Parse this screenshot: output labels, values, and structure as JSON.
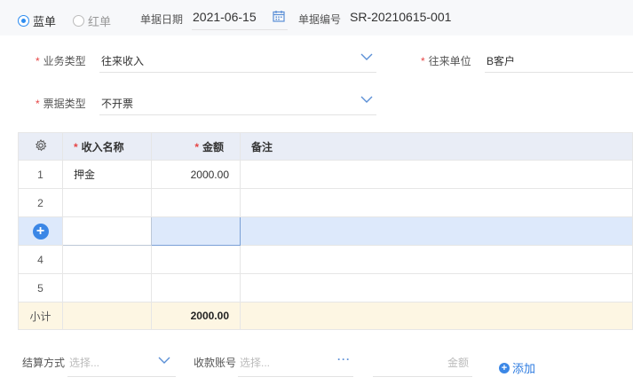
{
  "header": {
    "type_blue": "蓝单",
    "type_red": "红单",
    "date_label": "单据日期",
    "date_value": "2021-06-15",
    "no_label": "单据编号",
    "no_value": "SR-20210615-001"
  },
  "form": {
    "business_type_label": "业务类型",
    "business_type_value": "往来收入",
    "partner_label": "往来单位",
    "partner_value": "B客户",
    "invoice_type_label": "票据类型",
    "invoice_type_value": "不开票",
    "required_mark": "*"
  },
  "table": {
    "headers": {
      "name": "收入名称",
      "amount": "金额",
      "note": "备注"
    },
    "rows": [
      {
        "idx": "1",
        "name": "押金",
        "amount": "2000.00",
        "note": ""
      },
      {
        "idx": "2",
        "name": "",
        "amount": "",
        "note": ""
      },
      {
        "idx": "",
        "name": "",
        "amount": "",
        "note": ""
      },
      {
        "idx": "4",
        "name": "",
        "amount": "",
        "note": ""
      },
      {
        "idx": "5",
        "name": "",
        "amount": "",
        "note": ""
      }
    ],
    "subtotal_label": "小计",
    "subtotal_amount": "2000.00"
  },
  "settlement": {
    "method_label": "结算方式",
    "method_placeholder": "选择...",
    "account_label": "收款账号",
    "account_placeholder": "选择...",
    "amount_placeholder": "金额",
    "add_label": "添加"
  },
  "colors": {
    "accent": "#2d8cf0",
    "required": "#e64545",
    "subtotal_bg": "#fdf6e3",
    "active_row": "#dde9fb"
  }
}
